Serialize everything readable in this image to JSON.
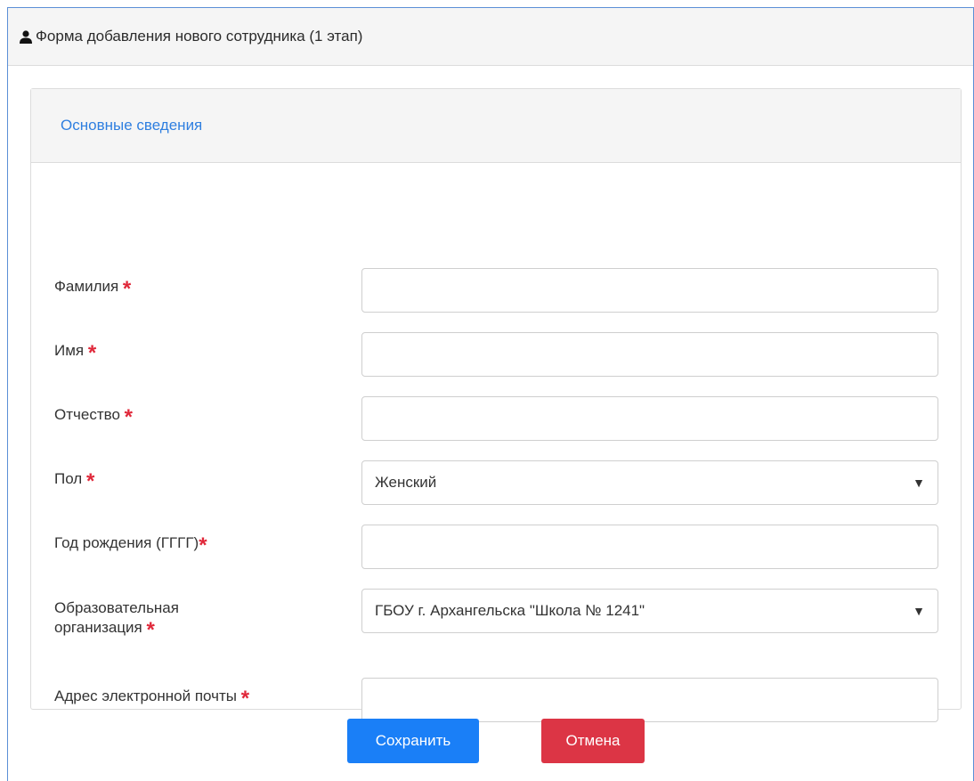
{
  "window": {
    "title": "Форма добавления нового сотрудника (1 этап)",
    "icon": "user-icon"
  },
  "card": {
    "title": "Основные сведения"
  },
  "form": {
    "required_mark": "*",
    "fields": [
      {
        "label": "Фамилия",
        "value": ""
      },
      {
        "label": "Имя",
        "value": ""
      },
      {
        "label": "Отчество",
        "value": ""
      },
      {
        "label": "Пол",
        "value": "Женский",
        "type": "select"
      },
      {
        "label": "Год рождения (ГГГГ)",
        "value": ""
      },
      {
        "label": "Образовательная организация",
        "value": "ГБОУ г. Архангельска \"Школа № 1241\"",
        "type": "select"
      },
      {
        "label": "Адрес электронной почты",
        "value": ""
      }
    ]
  },
  "buttons": {
    "save": "Сохранить",
    "cancel": "Отмена"
  },
  "colors": {
    "primary": "#1a7ff7",
    "danger": "#dc3545",
    "required": "#e0283a",
    "link": "#2f7fe0"
  }
}
